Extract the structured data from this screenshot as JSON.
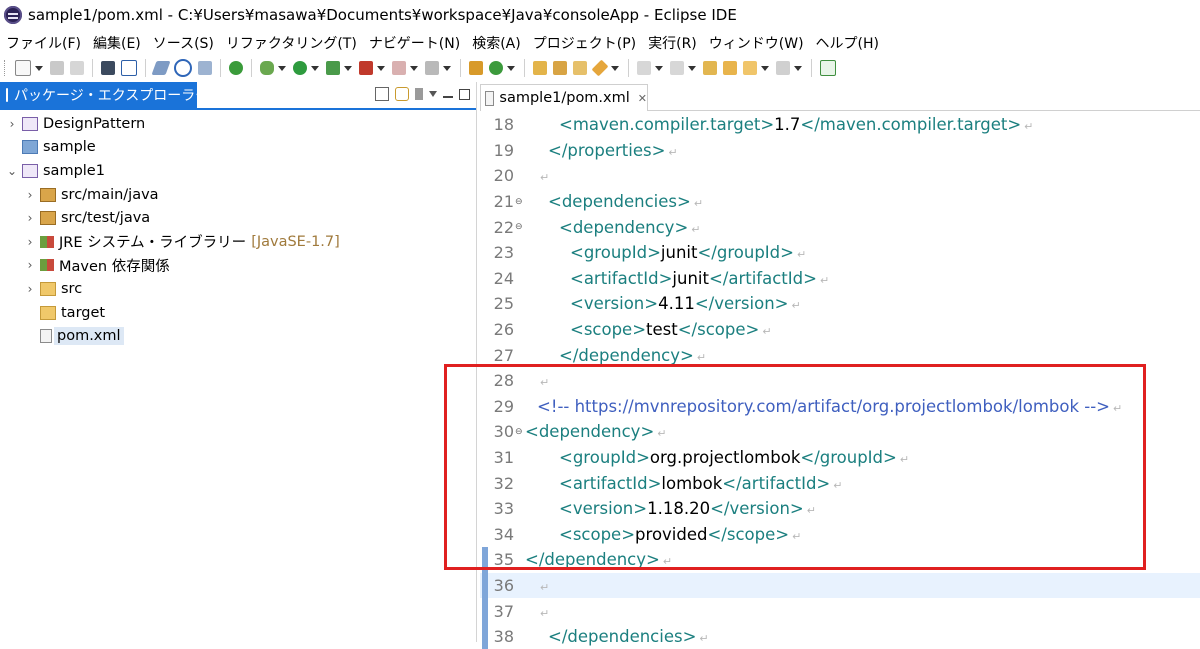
{
  "window": {
    "title": "sample1/pom.xml - C:¥Users¥masawa¥Documents¥workspace¥Java¥consoleApp - Eclipse IDE"
  },
  "menubar": [
    "ファイル(F)",
    "編集(E)",
    "ソース(S)",
    "リファクタリング(T)",
    "ナビゲート(N)",
    "検索(A)",
    "プロジェクト(P)",
    "実行(R)",
    "ウィンドウ(W)",
    "ヘルプ(H)"
  ],
  "explorer": {
    "tab_label": "パッケージ・エクスプローラー",
    "close_glyph": "✕",
    "items": [
      {
        "label": "DesignPattern",
        "twisty": ">",
        "icon": "project-icon",
        "decoration": ""
      },
      {
        "label": "sample",
        "twisty": "",
        "icon": "folder-project-icon",
        "decoration": ""
      },
      {
        "label": "sample1",
        "twisty": "v",
        "icon": "project-icon",
        "decoration": ""
      },
      {
        "label": "src/main/java",
        "twisty": ">",
        "icon": "source-folder-icon",
        "decoration": ""
      },
      {
        "label": "src/test/java",
        "twisty": ">",
        "icon": "source-folder-icon",
        "decoration": ""
      },
      {
        "label": "JRE システム・ライブラリー",
        "twisty": ">",
        "icon": "library-icon",
        "decoration": "[JavaSE-1.7]"
      },
      {
        "label": "Maven 依存関係",
        "twisty": ">",
        "icon": "library-icon",
        "decoration": ""
      },
      {
        "label": "src",
        "twisty": ">",
        "icon": "folder-icon",
        "decoration": ""
      },
      {
        "label": "target",
        "twisty": "",
        "icon": "folder-icon",
        "decoration": ""
      },
      {
        "label": "pom.xml",
        "twisty": "",
        "icon": "xml-file-icon",
        "decoration": ""
      }
    ]
  },
  "editor": {
    "tab_label": "sample1/pom.xml",
    "close_glyph": "✕",
    "lines": [
      {
        "num": "18",
        "fold": "",
        "indent": 2,
        "parts": [
          [
            "tag",
            "<maven.compiler.target>"
          ],
          [
            "txt",
            "1.7"
          ],
          [
            "tag",
            "</maven.compiler.target>"
          ]
        ]
      },
      {
        "num": "19",
        "fold": "",
        "indent": 1,
        "parts": [
          [
            "tag",
            "</properties>"
          ]
        ]
      },
      {
        "num": "20",
        "fold": "",
        "indent": 0,
        "parts": []
      },
      {
        "num": "21",
        "fold": "⊖",
        "indent": 1,
        "parts": [
          [
            "tag",
            "<dependencies>"
          ]
        ]
      },
      {
        "num": "22",
        "fold": "⊖",
        "indent": 2,
        "parts": [
          [
            "tag",
            "<dependency>"
          ]
        ]
      },
      {
        "num": "23",
        "fold": "",
        "indent": 3,
        "parts": [
          [
            "tag",
            "<groupId>"
          ],
          [
            "txt",
            "junit"
          ],
          [
            "tag",
            "</groupId>"
          ]
        ]
      },
      {
        "num": "24",
        "fold": "",
        "indent": 3,
        "parts": [
          [
            "tag",
            "<artifactId>"
          ],
          [
            "txt",
            "junit"
          ],
          [
            "tag",
            "</artifactId>"
          ]
        ]
      },
      {
        "num": "25",
        "fold": "",
        "indent": 3,
        "parts": [
          [
            "tag",
            "<version>"
          ],
          [
            "txt",
            "4.11"
          ],
          [
            "tag",
            "</version>"
          ]
        ]
      },
      {
        "num": "26",
        "fold": "",
        "indent": 3,
        "parts": [
          [
            "tag",
            "<scope>"
          ],
          [
            "txt",
            "test"
          ],
          [
            "tag",
            "</scope>"
          ]
        ]
      },
      {
        "num": "27",
        "fold": "",
        "indent": 2,
        "parts": [
          [
            "tag",
            "</dependency>"
          ]
        ]
      },
      {
        "num": "28",
        "fold": "",
        "indent": 0,
        "parts": []
      },
      {
        "num": "29",
        "fold": "",
        "indent": 0,
        "parts": [
          [
            "comment",
            "<!-- https://mvnrepository.com/artifact/org.projectlombok/lombok -->"
          ]
        ]
      },
      {
        "num": "30",
        "fold": "⊖",
        "indent": -1,
        "parts": [
          [
            "tag",
            "<dependency>"
          ]
        ]
      },
      {
        "num": "31",
        "fold": "",
        "indent": 2,
        "parts": [
          [
            "tag",
            "<groupId>"
          ],
          [
            "txt",
            "org.projectlombok"
          ],
          [
            "tag",
            "</groupId>"
          ]
        ]
      },
      {
        "num": "32",
        "fold": "",
        "indent": 2,
        "parts": [
          [
            "tag",
            "<artifactId>"
          ],
          [
            "txt",
            "lombok"
          ],
          [
            "tag",
            "</artifactId>"
          ]
        ]
      },
      {
        "num": "33",
        "fold": "",
        "indent": 2,
        "parts": [
          [
            "tag",
            "<version>"
          ],
          [
            "txt",
            "1.18.20"
          ],
          [
            "tag",
            "</version>"
          ]
        ]
      },
      {
        "num": "34",
        "fold": "",
        "indent": 2,
        "parts": [
          [
            "tag",
            "<scope>"
          ],
          [
            "txt",
            "provided"
          ],
          [
            "tag",
            "</scope>"
          ]
        ]
      },
      {
        "num": "35",
        "fold": "",
        "indent": -1,
        "parts": [
          [
            "tag",
            "</dependency>"
          ]
        ]
      },
      {
        "num": "36",
        "fold": "",
        "indent": 0,
        "parts": [],
        "current": true
      },
      {
        "num": "37",
        "fold": "",
        "indent": 0,
        "parts": []
      },
      {
        "num": "38",
        "fold": "",
        "indent": 1,
        "parts": [
          [
            "tag",
            "</dependencies>"
          ]
        ]
      }
    ],
    "pilcrow": "↵",
    "highlight_color": "#e02020"
  }
}
